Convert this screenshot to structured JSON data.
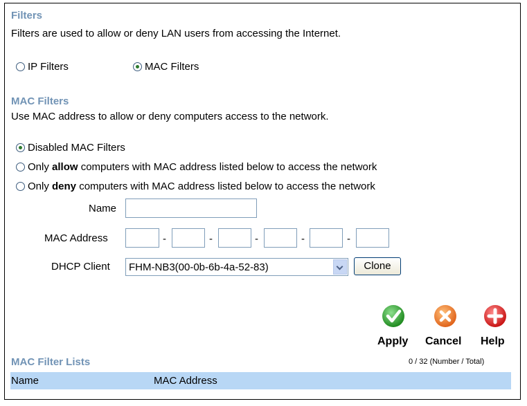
{
  "filters": {
    "title": "Filters",
    "description": "Filters are used to allow or deny LAN users from accessing the Internet.",
    "options": [
      {
        "label": "IP Filters",
        "selected": false
      },
      {
        "label": "MAC Filters",
        "selected": true
      }
    ]
  },
  "mac_filters": {
    "title": "MAC Filters",
    "description": "Use MAC address to allow or deny computers access to the network.",
    "modes": [
      {
        "label": "Disabled MAC Filters",
        "selected": true
      },
      {
        "prefix": "Only ",
        "bold": "allow",
        "suffix": " computers with MAC address listed below to access the network",
        "selected": false
      },
      {
        "prefix": "Only ",
        "bold": "deny",
        "suffix": " computers with MAC address listed below to access the network",
        "selected": false
      }
    ]
  },
  "form": {
    "name_label": "Name",
    "name_value": "",
    "mac_label": "MAC Address",
    "mac_separator": "-",
    "dhcp_label": "DHCP Client",
    "dhcp_selected": "FHM-NB3(00-0b-6b-4a-52-83)",
    "clone_label": "Clone"
  },
  "actions": {
    "apply": "Apply",
    "cancel": "Cancel",
    "help": "Help"
  },
  "list": {
    "title": "MAC Filter Lists",
    "count": "0 / 32 (Number / Total)",
    "columns": [
      "Name",
      "MAC Address"
    ]
  },
  "colors": {
    "heading": "#7193b5",
    "list_header_bg": "#b8d7f5",
    "apply_icon": "#2f9a2f",
    "cancel_icon": "#e8782a",
    "help_icon": "#d42020"
  },
  "icons": {
    "apply": "check-icon",
    "cancel": "x-icon",
    "help": "plus-icon"
  }
}
